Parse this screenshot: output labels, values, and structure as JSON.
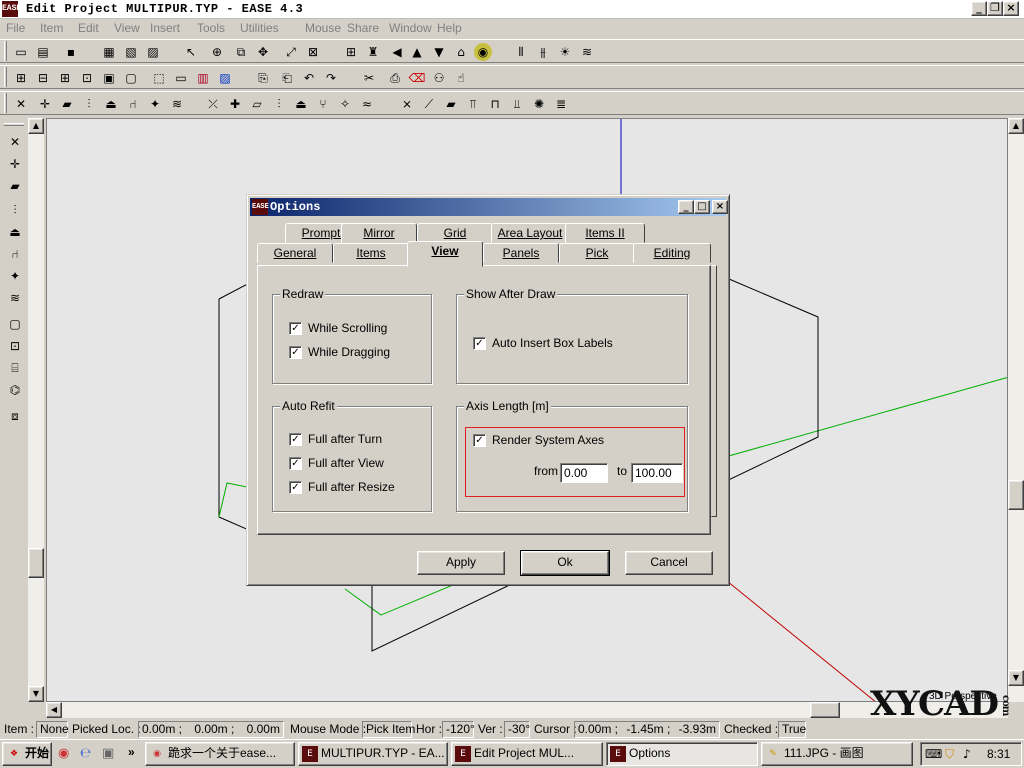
{
  "window": {
    "title": "Edit Project MULTIPUR.TYP - EASE 4.3",
    "logo": "EASE",
    "controls": [
      "minimize-icon",
      "restore-icon",
      "close-icon"
    ]
  },
  "menu": [
    "File",
    "Item",
    "Edit",
    "View",
    "Insert",
    "Tools",
    "Utilities",
    "Mouse",
    "Share",
    "Window",
    "Help"
  ],
  "dialog": {
    "title": "Options",
    "tabs_row_back": [
      "Prompts",
      "Mirror",
      "Grid",
      "Area Layout",
      "Items II"
    ],
    "tabs_row_front": [
      "General",
      "Items",
      "View",
      "Panels",
      "Pick",
      "Editing"
    ],
    "active_tab": "View",
    "redraw": {
      "label": "Redraw",
      "while_scrolling": "While Scrolling",
      "while_dragging": "While Dragging"
    },
    "show_after_draw": {
      "label": "Show After Draw",
      "auto_insert": "Auto Insert Box Labels"
    },
    "auto_refit": {
      "label": "Auto Refit",
      "turn": "Full after Turn",
      "view": "Full after View",
      "resize": "Full after Resize"
    },
    "axis_length": {
      "label": "Axis Length [m]",
      "render": "Render System Axes",
      "from_label": "from",
      "from_value": "0.00",
      "to_label": "to",
      "to_value": "100.00"
    },
    "checked": "✓",
    "buttons": {
      "apply": "Apply",
      "ok": "Ok",
      "cancel": "Cancel"
    }
  },
  "viewport": {
    "view_label": "3D Perspective"
  },
  "status": {
    "item_label": "Item :",
    "item_value": "None",
    "picked_label": "Picked Loc. :",
    "picked_x": "0.00m ;",
    "picked_y": "0.00m ;",
    "picked_z": "0.00m",
    "mouse_label": "Mouse Mode :",
    "mouse_value": "Pick Item",
    "hor_label": "Hor :",
    "hor_value": "-120°",
    "ver_label": "Ver :",
    "ver_value": "-30°",
    "cursor_label": "Cursor :",
    "cursor_x": "0.00m ;",
    "cursor_y": "-1.45m ;",
    "cursor_z": "-3.93m",
    "checked_label": "Checked :",
    "checked_value": "True"
  },
  "taskbar": {
    "start": "开始",
    "tasks": [
      "跪求一个关于ease...",
      "MULTIPUR.TYP - EA...",
      "Edit Project MUL...",
      "Options",
      "111.JPG - 画图"
    ],
    "clock": "8:31",
    "more": "»"
  },
  "watermark": "XYCAD",
  "watermark_small": "com"
}
